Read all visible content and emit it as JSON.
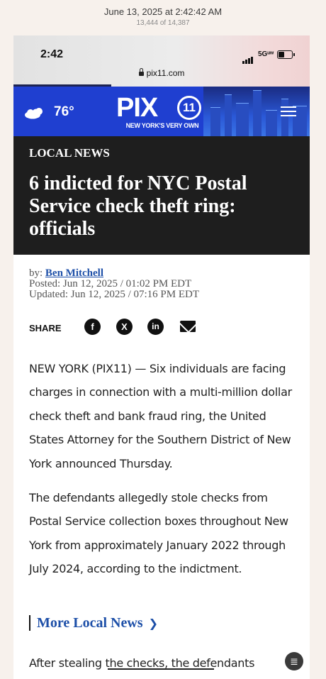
{
  "photo_header": {
    "date": "June 13, 2025 at 2:42:42 AM",
    "count": "13,444 of 14,387"
  },
  "status_bar": {
    "time": "2:42",
    "network": "5Gᵘʷ",
    "url": "pix11.com"
  },
  "nav": {
    "temperature": "76°",
    "logo_text": "PIX",
    "logo_number": "11",
    "logo_tagline": "NEW YORK'S VERY OWN",
    "weather_icon": "cloud-sun-icon",
    "menu_icon": "hamburger-menu-icon",
    "brand_color": "#1f3fd0"
  },
  "article": {
    "kicker": "LOCAL NEWS",
    "headline": "6 indicted for NYC Postal Service check theft ring: officials",
    "byline_prefix": "by:",
    "author": "Ben Mitchell",
    "posted": "Posted: Jun 12, 2025 / 01:02 PM EDT",
    "updated": "Updated: Jun 12, 2025 / 07:16 PM EDT",
    "share_label": "SHARE",
    "share_icons": [
      "facebook-icon",
      "x-icon",
      "linkedin-icon",
      "email-icon"
    ],
    "paragraphs": [
      "NEW YORK (PIX11) — Six individuals are facing charges in connection with a multi-million dollar check theft and bank fraud ring, the United States Attorney for the Southern District of New York announced Thursday.",
      "The defendants allegedly stole checks from Postal Service collection boxes throughout New York from approximately January 2022 through July 2024, according to the indictment."
    ],
    "more_link": "More Local News",
    "tail_text": "After stealing the checks, the defendants"
  },
  "link_color": "#1d4fa8"
}
